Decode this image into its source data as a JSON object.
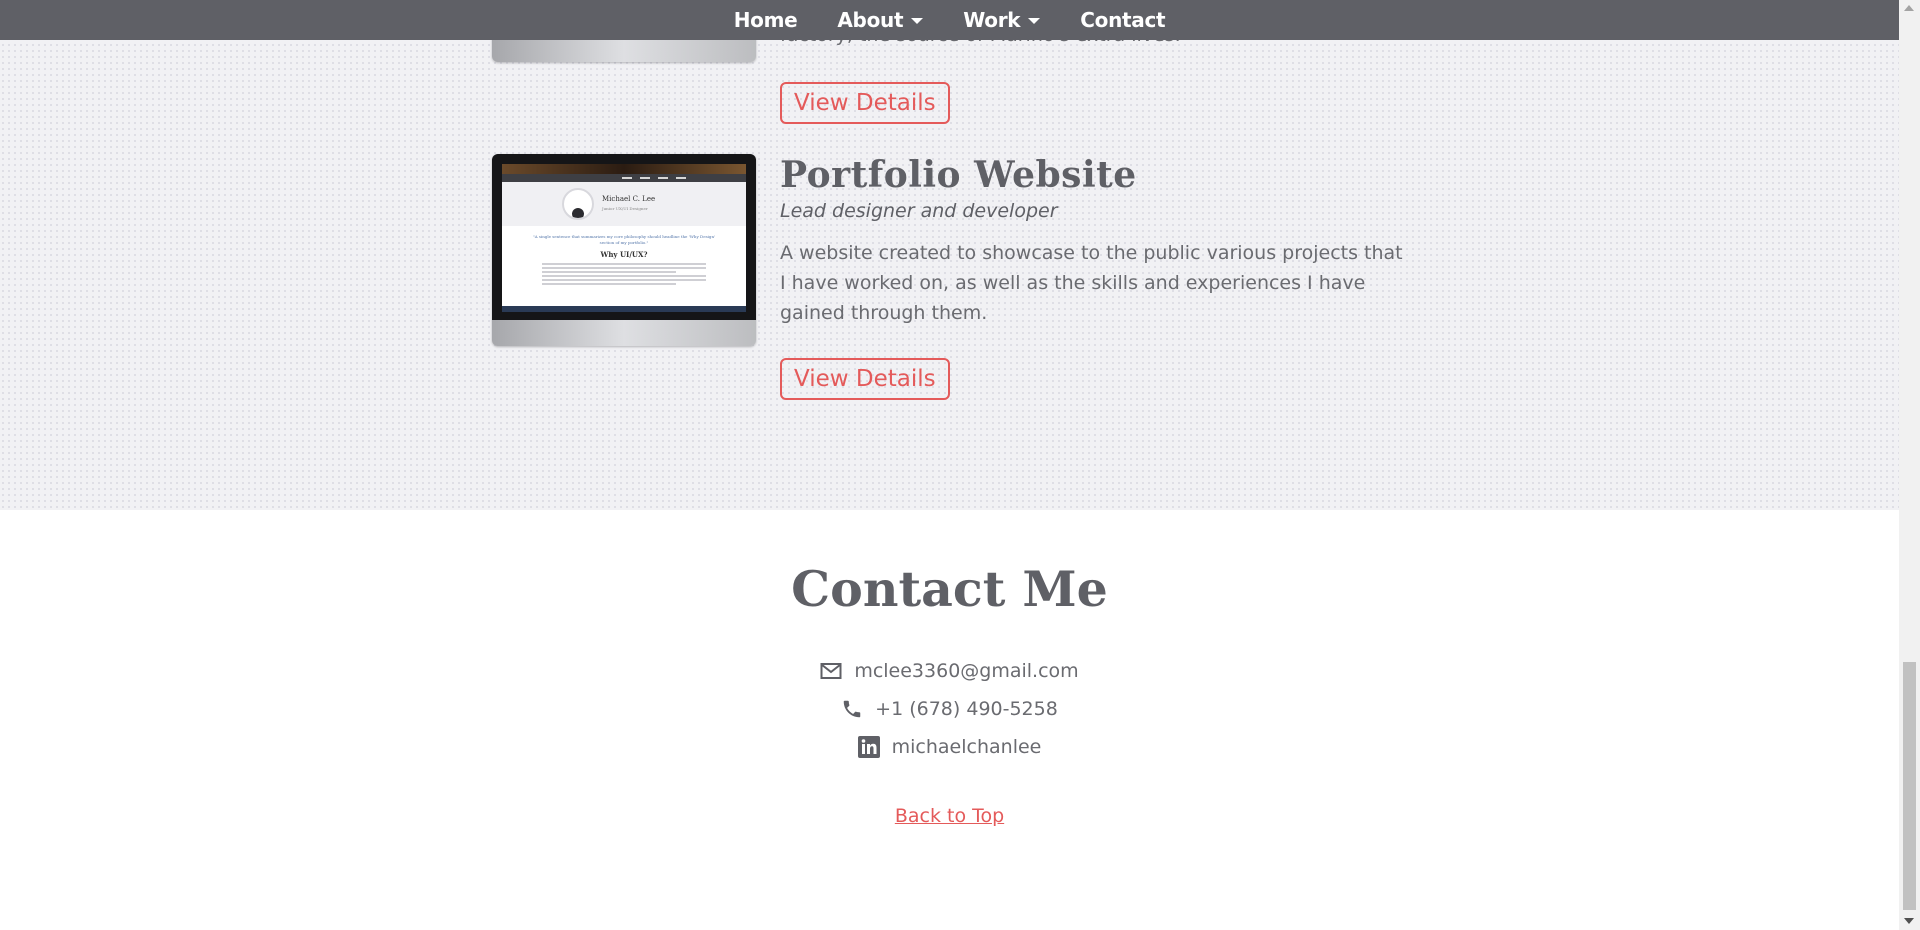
{
  "nav": {
    "items": [
      {
        "label": "Home",
        "dropdown": false
      },
      {
        "label": "About",
        "dropdown": true
      },
      {
        "label": "Work",
        "dropdown": true
      },
      {
        "label": "Contact",
        "dropdown": false
      }
    ]
  },
  "work": {
    "prev_project": {
      "desc_partial": "factory, the source of Marino's extra lives.",
      "button_label": "View Details"
    },
    "project": {
      "title": "Portfolio Website",
      "role": "Lead designer and developer",
      "description": "A website created to showcase to the public various projects that I have worked on, as well as the skills and experiences I have gained through them.",
      "button_label": "View Details",
      "screenshot": {
        "name": "Michael C. Lee",
        "subtitle": "Junior UX/UI Designer",
        "quote": "\"A single sentence that summarizes my core philosophy should headline the 'Why Design' section of my portfolio.\"",
        "heading": "Why UI/UX?"
      }
    }
  },
  "contact": {
    "title": "Contact Me",
    "email": "mclee3360@gmail.com",
    "phone": "+1 (678) 490-5258",
    "linkedin": "michaelchanlee",
    "back_to_top": "Back to Top"
  },
  "colors": {
    "navbar": "#5f6066",
    "accent": "#e45a5a",
    "text": "#5f6066"
  },
  "icons": [
    "mail-icon",
    "phone-icon",
    "linkedin-icon",
    "caret-down-icon"
  ]
}
